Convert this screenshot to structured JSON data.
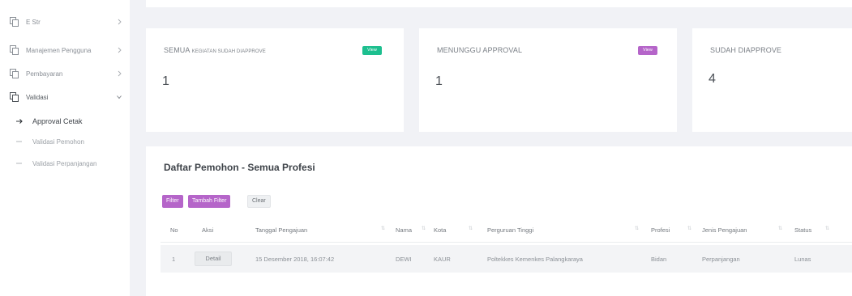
{
  "sidebar": {
    "items": [
      {
        "label": "E Str",
        "icon": "copy-icon"
      },
      {
        "label": "Manajemen Pengguna",
        "icon": "copy-icon"
      },
      {
        "label": "Pembayaran",
        "icon": "copy-icon"
      },
      {
        "label": "Validasi",
        "icon": "copy-icon"
      }
    ],
    "subitems": [
      {
        "label": "Approval Cetak"
      },
      {
        "label": "Validasi Pemohon"
      },
      {
        "label": "Validasi Perpanjangan"
      }
    ]
  },
  "cards": [
    {
      "title": "SEMUA",
      "title_small": "KEGIATAN SUDAH DIAPPROVE",
      "value": "1",
      "badge": "View",
      "badge_color": "#1dbf8f"
    },
    {
      "title": "MENUNGGU APPROVAL",
      "value": "1",
      "badge": "View",
      "badge_color": "#b565c9"
    },
    {
      "title": "SUDAH DIAPPROVE",
      "value": "4"
    }
  ],
  "panel": {
    "title": "Daftar Pemohon - Semua Profesi",
    "buttons": {
      "filter": "Filter",
      "add_filter": "Tambah Filter",
      "clear": "Clear"
    },
    "columns": [
      "No",
      "Aksi",
      "Tanggal Pengajuan",
      "Nama",
      "Kota",
      "Perguruan Tinggi",
      "Profesi",
      "Jenis Pengajuan",
      "Status"
    ],
    "rows": [
      {
        "no": "1",
        "action": "Detail",
        "date": "15 Desember 2018, 16:07:42",
        "name": "DEWI",
        "city": "KAUR",
        "university": "Poltekkes Kemenkes Palangkaraya",
        "profession": "Bidan",
        "type": "Perpanjangan",
        "status": "Lunas"
      }
    ]
  }
}
